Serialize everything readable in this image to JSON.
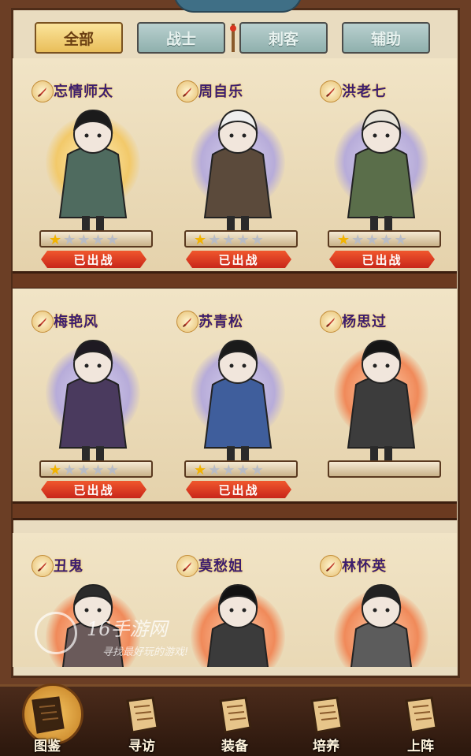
{
  "tabs": [
    {
      "label": "全部",
      "active": true
    },
    {
      "label": "战士",
      "active": false
    },
    {
      "label": "刺客",
      "active": false
    },
    {
      "label": "辅助",
      "active": false
    }
  ],
  "heroes": [
    {
      "name": "忘情师太",
      "class_icon": "sword-icon",
      "stars": 1,
      "max_stars": 5,
      "status": "已出战",
      "halo": "gold"
    },
    {
      "name": "周自乐",
      "class_icon": "sword-icon",
      "stars": 1,
      "max_stars": 5,
      "status": "已出战",
      "halo": "blue"
    },
    {
      "name": "洪老七",
      "class_icon": "sword-icon",
      "stars": 1,
      "max_stars": 5,
      "status": "已出战",
      "halo": "blue"
    },
    {
      "name": "梅艳风",
      "class_icon": "sword-icon",
      "stars": 1,
      "max_stars": 5,
      "status": "已出战",
      "halo": "blue"
    },
    {
      "name": "苏青松",
      "class_icon": "sword-icon",
      "stars": 1,
      "max_stars": 5,
      "status": "已出战",
      "halo": "blue"
    },
    {
      "name": "杨思过",
      "class_icon": "sword-icon",
      "stars": 0,
      "max_stars": 5,
      "status": "",
      "halo": "orange"
    },
    {
      "name": "丑鬼",
      "class_icon": "sword-icon",
      "stars": 0,
      "max_stars": 5,
      "status": "",
      "halo": "orange"
    },
    {
      "name": "莫愁姐",
      "class_icon": "sword-icon",
      "stars": 0,
      "max_stars": 5,
      "status": "",
      "halo": "orange"
    },
    {
      "name": "林怀英",
      "class_icon": "sword-icon",
      "stars": 0,
      "max_stars": 5,
      "status": "",
      "halo": "orange"
    }
  ],
  "watermark": {
    "title": "16手游网",
    "subtitle": "寻找最好玩的游戏!"
  },
  "bottom_nav": [
    {
      "label": "图鉴",
      "icon": "scroll-icon",
      "active": true
    },
    {
      "label": "寻访",
      "icon": "book-icon",
      "active": false
    },
    {
      "label": "装备",
      "icon": "armor-icon",
      "active": false
    },
    {
      "label": "培养",
      "icon": "manual-icon",
      "active": false
    },
    {
      "label": "上阵",
      "icon": "banner-icon",
      "active": false
    }
  ],
  "colors": {
    "frame": "#6b3e25",
    "tab_active": "#f0c766",
    "tab_inactive": "#a8c3c1",
    "name_text": "#3c1d6e",
    "deployed_banner": "#d8341f",
    "star_on": "#f2b300",
    "star_off": "#b8bcc5"
  }
}
